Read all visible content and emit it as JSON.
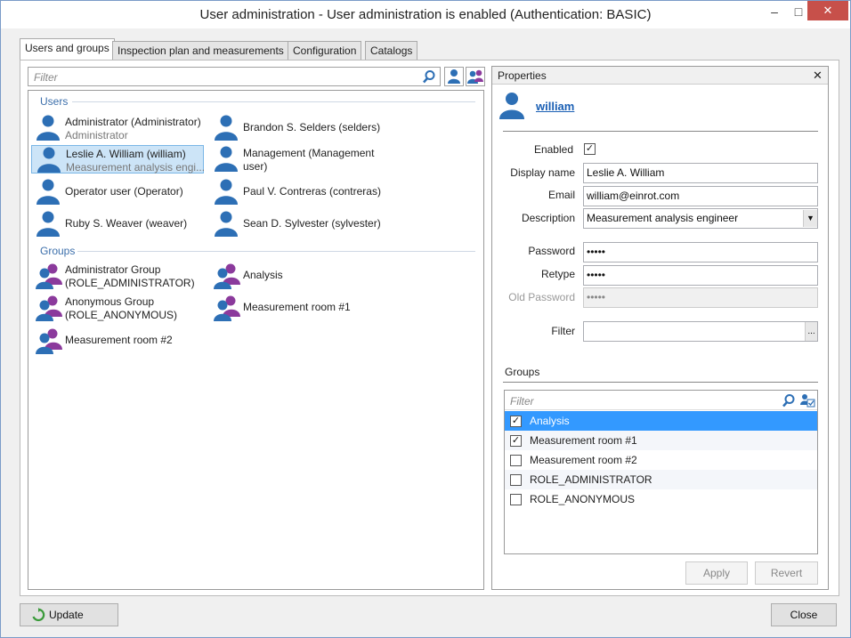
{
  "window": {
    "title": "User administration - User administration is enabled (Authentication: BASIC)",
    "minimize": "–",
    "maximize": "□",
    "close": "✕"
  },
  "tabs": [
    "Users and groups",
    "Inspection plan and measurements",
    "Configuration",
    "Catalogs"
  ],
  "left": {
    "filter_placeholder": "Filter",
    "users_header": "Users",
    "groups_header": "Groups",
    "users": [
      {
        "line1": "Administrator (Administrator)",
        "line2": "Administrator"
      },
      {
        "line1": "Brandon S. Selders (selders)",
        "line2": ""
      },
      {
        "line1": "Leslie A. William (william)",
        "line2": "Measurement analysis engi..."
      },
      {
        "line1": "Management (Management",
        "line2": "user)"
      },
      {
        "line1": "Operator user (Operator)",
        "line2": ""
      },
      {
        "line1": "Paul V. Contreras (contreras)",
        "line2": ""
      },
      {
        "line1": "Ruby S. Weaver (weaver)",
        "line2": ""
      },
      {
        "line1": "Sean D. Sylvester (sylvester)",
        "line2": ""
      }
    ],
    "groups": [
      {
        "line1": "Administrator Group",
        "line2": "(ROLE_ADMINISTRATOR)"
      },
      {
        "line1": "Analysis",
        "line2": ""
      },
      {
        "line1": "Anonymous Group",
        "line2": "(ROLE_ANONYMOUS)"
      },
      {
        "line1": "Measurement room #1",
        "line2": ""
      },
      {
        "line1": "Measurement room #2",
        "line2": ""
      }
    ]
  },
  "properties": {
    "title": "Properties",
    "close": "✕",
    "username": "william",
    "enabled_label": "Enabled",
    "enabled_check": "✓",
    "display_name_label": "Display name",
    "display_name": "Leslie A. William",
    "email_label": "Email",
    "email": "william@einrot.com",
    "description_label": "Description",
    "description": "Measurement analysis engineer",
    "password_label": "Password",
    "password": "•••••",
    "retype_label": "Retype",
    "retype": "•••••",
    "old_password_label": "Old Password",
    "old_password": "•••••",
    "filter_label": "Filter",
    "filter_value": "",
    "browse_label": "...",
    "groups_header": "Groups",
    "groups_filter_placeholder": "Filter",
    "groups": [
      {
        "name": "Analysis",
        "check": "✓"
      },
      {
        "name": "Measurement room #1",
        "check": "✓"
      },
      {
        "name": "Measurement room #2",
        "check": ""
      },
      {
        "name": "ROLE_ADMINISTRATOR",
        "check": ""
      },
      {
        "name": "ROLE_ANONYMOUS",
        "check": ""
      }
    ],
    "apply": "Apply",
    "revert": "Revert"
  },
  "footer": {
    "update": "Update",
    "close": "Close"
  },
  "colors": {
    "accent": "#3c7fd1",
    "selection": "#3399ff",
    "user_icon": "#2d6fb5",
    "group_icon_female": "#8b3a9c"
  }
}
